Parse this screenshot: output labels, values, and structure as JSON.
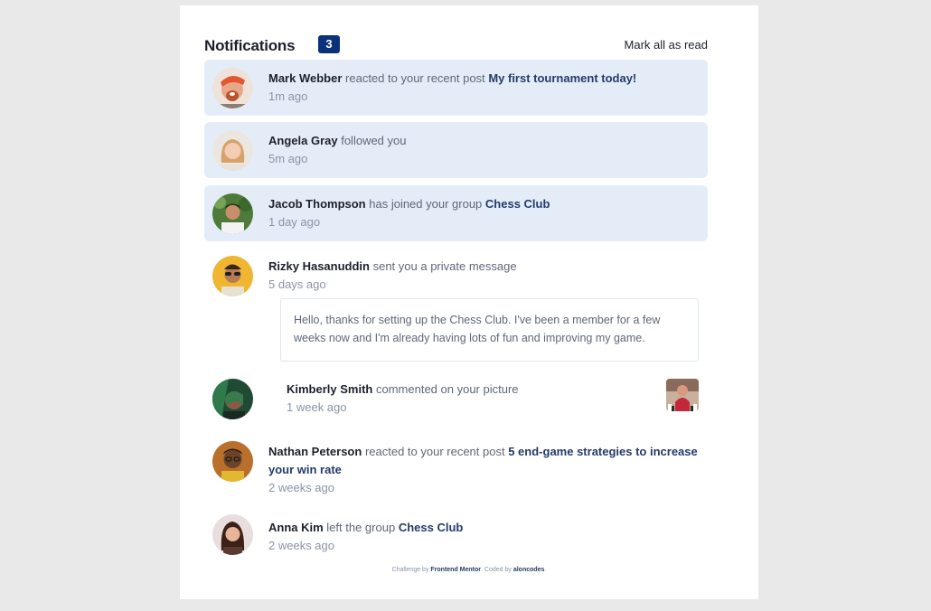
{
  "header": {
    "title": "Notifications",
    "count": "3",
    "mark_all": "Mark all as read"
  },
  "notifications": [
    {
      "name": "Mark Webber",
      "action": "reacted to your recent post",
      "target": "My first tournament today!",
      "time": "1m ago",
      "unread": true
    },
    {
      "name": "Angela Gray",
      "action": "followed you",
      "target": "",
      "time": "5m ago",
      "unread": true
    },
    {
      "name": "Jacob Thompson",
      "action": "has joined your group",
      "target": "Chess Club",
      "time": "1 day ago",
      "unread": true
    },
    {
      "name": "Rizky Hasanuddin",
      "action": "sent you a private message",
      "target": "",
      "time": "5 days ago",
      "unread": false,
      "message": "Hello, thanks for setting up the Chess Club. I've been a member for a few weeks now and I'm already having lots of fun and improving my game."
    },
    {
      "name": "Kimberly Smith",
      "action": "commented on your picture",
      "target": "",
      "time": "1 week ago",
      "unread": false
    },
    {
      "name": "Nathan Peterson",
      "action": "reacted to your recent post",
      "target": "5 end-game strategies to increase your win rate",
      "time": "2 weeks ago",
      "unread": false
    },
    {
      "name": "Anna Kim",
      "action": "left the group",
      "target": "Chess Club",
      "time": "2 weeks ago",
      "unread": false
    }
  ],
  "footer": {
    "prefix": "Challenge by",
    "link1": "Frontend Mentor",
    "middle": ". Coded by",
    "link2": "aloncodes",
    "suffix": "."
  }
}
